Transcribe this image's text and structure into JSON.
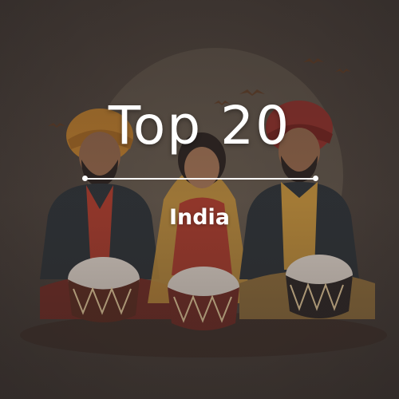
{
  "playlist": {
    "title": "Top 20",
    "subtitle": "India"
  },
  "colors": {
    "background": "#3b3430",
    "text": "#ffffff",
    "turban_orange": "#b4782c",
    "turban_red": "#8a2f2a",
    "vest_dark": "#2c3136",
    "dupatta_yellow": "#b98a3a"
  },
  "icons": {
    "artwork": "bhangra-drummers-illustration",
    "divider": "line-with-dot-ends"
  }
}
